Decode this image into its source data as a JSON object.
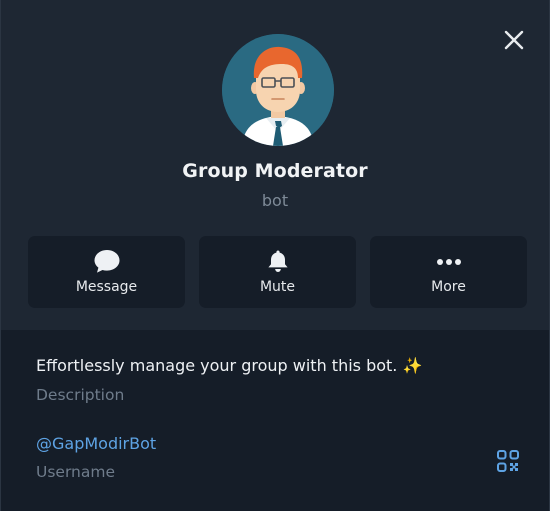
{
  "profile": {
    "name": "Group Moderator",
    "type": "bot",
    "avatar": "man-with-glasses-and-tie-avatar"
  },
  "actions": [
    {
      "label": "Message",
      "icon": "chat-bubble-icon"
    },
    {
      "label": "Mute",
      "icon": "bell-icon"
    },
    {
      "label": "More",
      "icon": "more-dots-icon"
    }
  ],
  "info": {
    "description": "Effortlessly manage your group with this bot.",
    "description_emoji": "✨",
    "description_label": "Description",
    "username": "@GapModirBot",
    "username_label": "Username"
  },
  "icons": {
    "close": "close-icon",
    "qr": "qr-code-icon"
  },
  "colors": {
    "accent": "#5ea3e4",
    "background": "#151d28",
    "header": "#1e2733",
    "muted_text": "#6f7c8b"
  }
}
